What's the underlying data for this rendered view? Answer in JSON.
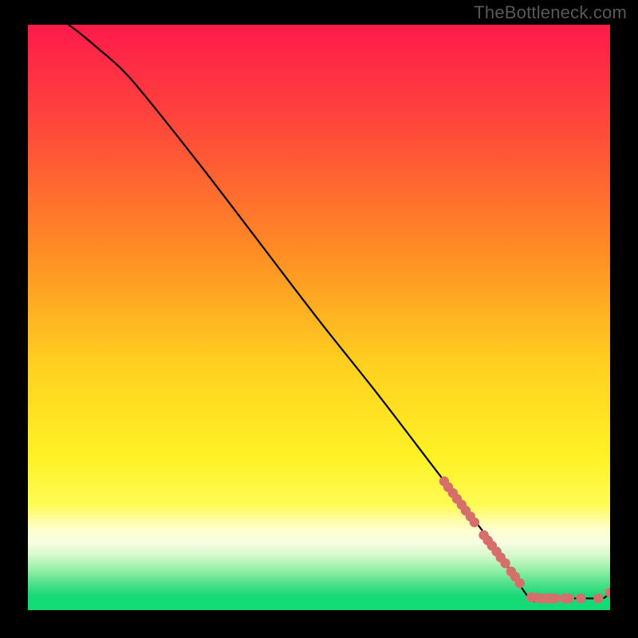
{
  "attribution": "TheBottleneck.com",
  "chart_data": {
    "type": "line",
    "title": "",
    "xlabel": "",
    "ylabel": "",
    "xlim": [
      0,
      100
    ],
    "ylim": [
      0,
      100
    ],
    "grid": false,
    "curve": {
      "description": "Primary curve: begins near (7,100), shallow drop to ~(16,92.5), then nearly linear descent to ~(86,2), then flat along y≈2 to x≈100 with slight uptick at the end.",
      "x": [
        7,
        9,
        12,
        16,
        20,
        30,
        40,
        50,
        60,
        70,
        80,
        86,
        88,
        90,
        92,
        94,
        96,
        98,
        99,
        100
      ],
      "y": [
        100,
        98.5,
        96,
        92.5,
        88,
        75.5,
        62.5,
        49.5,
        37,
        24,
        11,
        2.2,
        2.0,
        2.0,
        2.0,
        2.0,
        2.0,
        2.0,
        2.1,
        3.0
      ]
    },
    "markers": {
      "description": "Salmon-colored circular markers along the tail end of the curve forming a dense band on the descending segment and a sparser row along the floor.",
      "color": "#d66f6c",
      "points": [
        {
          "x": 71.5,
          "y": 22.0
        },
        {
          "x": 72.2,
          "y": 21.0
        },
        {
          "x": 73.0,
          "y": 20.0
        },
        {
          "x": 73.7,
          "y": 19.0
        },
        {
          "x": 74.5,
          "y": 18.0
        },
        {
          "x": 75.2,
          "y": 17.0
        },
        {
          "x": 76.0,
          "y": 16.0
        },
        {
          "x": 76.7,
          "y": 15.0
        },
        {
          "x": 78.3,
          "y": 12.8
        },
        {
          "x": 79.0,
          "y": 11.9
        },
        {
          "x": 79.7,
          "y": 11.0
        },
        {
          "x": 80.5,
          "y": 10.0
        },
        {
          "x": 81.2,
          "y": 9.0
        },
        {
          "x": 82.0,
          "y": 8.0
        },
        {
          "x": 83.0,
          "y": 6.6
        },
        {
          "x": 83.7,
          "y": 5.7
        },
        {
          "x": 84.5,
          "y": 4.6
        },
        {
          "x": 86.5,
          "y": 2.2
        },
        {
          "x": 87.4,
          "y": 2.1
        },
        {
          "x": 88.2,
          "y": 2.0
        },
        {
          "x": 89.0,
          "y": 2.0
        },
        {
          "x": 89.8,
          "y": 2.0
        },
        {
          "x": 90.6,
          "y": 2.0
        },
        {
          "x": 92.2,
          "y": 2.0
        },
        {
          "x": 93.0,
          "y": 2.0
        },
        {
          "x": 95.0,
          "y": 2.0
        },
        {
          "x": 98.0,
          "y": 2.0
        },
        {
          "x": 100.0,
          "y": 3.0
        }
      ]
    },
    "background_bands": {
      "description": "Vertical gradient from red (top) through orange to yellow down to ~75% height, then yellow→pale-green→bright-green band near the bottom.",
      "stops": [
        {
          "offset": 0.0,
          "color": "#ff1a4a"
        },
        {
          "offset": 0.18,
          "color": "#ff4a3a"
        },
        {
          "offset": 0.38,
          "color": "#ff8a24"
        },
        {
          "offset": 0.58,
          "color": "#ffd020"
        },
        {
          "offset": 0.74,
          "color": "#fff225"
        },
        {
          "offset": 0.82,
          "color": "#fffb55"
        },
        {
          "offset": 0.86,
          "color": "#fffecc"
        },
        {
          "offset": 0.885,
          "color": "#f6fde0"
        },
        {
          "offset": 0.905,
          "color": "#d9f9cf"
        },
        {
          "offset": 0.93,
          "color": "#99f0a8"
        },
        {
          "offset": 0.955,
          "color": "#4ee089"
        },
        {
          "offset": 0.975,
          "color": "#18d977"
        },
        {
          "offset": 1.0,
          "color": "#0fdc73"
        }
      ]
    }
  }
}
